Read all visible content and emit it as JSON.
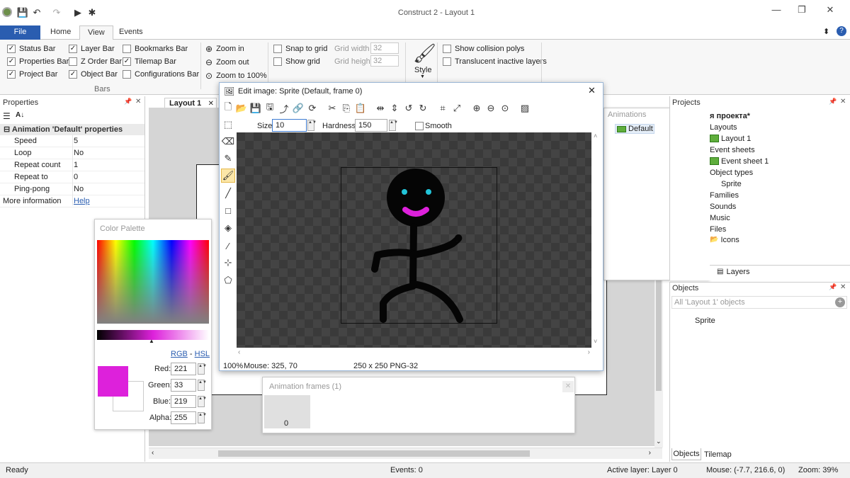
{
  "window": {
    "title": "Construct 2 - Layout 1",
    "min": "—",
    "restore": "❐",
    "close": "✕"
  },
  "ribbon_tabs": [
    "File",
    "Home",
    "View",
    "Events"
  ],
  "bars": {
    "col1": [
      {
        "label": "Status Bar",
        "checked": true
      },
      {
        "label": "Properties Bar",
        "checked": true
      },
      {
        "label": "Project Bar",
        "checked": true
      }
    ],
    "col2": [
      {
        "label": "Layer Bar",
        "checked": true
      },
      {
        "label": "Z Order Bar",
        "checked": false
      },
      {
        "label": "Object Bar",
        "checked": true
      }
    ],
    "col3": [
      {
        "label": "Bookmarks Bar",
        "checked": false
      },
      {
        "label": "Tilemap Bar",
        "checked": true
      },
      {
        "label": "Configurations Bar",
        "checked": false
      }
    ],
    "group_label": "Bars"
  },
  "zoom": {
    "in": "Zoom in",
    "out": "Zoom out",
    "reset": "Zoom to 100%"
  },
  "grid": {
    "snap": "Snap to grid",
    "show": "Show grid",
    "width_label": "Grid width",
    "width": "32",
    "height_label": "Grid height",
    "height": "32"
  },
  "style_label": "Style",
  "display": {
    "collision": "Show collision polys",
    "translucent": "Translucent inactive layers"
  },
  "properties": {
    "title": "Properties",
    "section": "Animation 'Default' properties",
    "rows": [
      {
        "key": "Speed",
        "value": "5"
      },
      {
        "key": "Loop",
        "value": "No"
      },
      {
        "key": "Repeat count",
        "value": "1"
      },
      {
        "key": "Repeat to",
        "value": "0"
      },
      {
        "key": "Ping-pong",
        "value": "No"
      }
    ],
    "more_label": "More information",
    "more_link": "Help"
  },
  "layout_tab": "Layout 1",
  "editor": {
    "title": "Edit image: Sprite (Default, frame 0)",
    "size_label": "Size",
    "size": "10",
    "hardness_label": "Hardness",
    "hardness": "150",
    "smooth": "Smooth",
    "status_zoom": "100%",
    "status_mouse": "Mouse: 325, 70",
    "status_dims": "250 x 250  PNG-32"
  },
  "palette": {
    "title": "Color Palette",
    "rgb": "RGB",
    "sep": " - ",
    "hsl": "HSL",
    "red_label": "Red:",
    "red": "221",
    "green_label": "Green:",
    "green": "33",
    "blue_label": "Blue:",
    "blue": "219",
    "alpha_label": "Alpha:",
    "alpha": "255",
    "primary_color": "#dd21db"
  },
  "animations": {
    "title": "Animations",
    "item": "Default"
  },
  "frames": {
    "title": "Animation frames (1)",
    "frame": "0"
  },
  "projects": {
    "title": "Projects",
    "items": [
      "я проекта*",
      "Layouts",
      "Layout 1",
      "Event sheets",
      "Event sheet 1",
      "Object types",
      "Sprite",
      "Families",
      "Sounds",
      "Music",
      "Files",
      "Icons"
    ],
    "layers_tab": "Layers"
  },
  "objects": {
    "title": "Objects",
    "filter": "All 'Layout 1' objects",
    "item": "Sprite",
    "tab1": "Objects",
    "tab2": "Tilemap"
  },
  "statusbar": {
    "ready": "Ready",
    "events": "Events: 0",
    "layer": "Active layer: Layer 0",
    "mouse": "Mouse: (-7.7, 216.6, 0)",
    "zoom": "Zoom: 39%"
  },
  "colors": {
    "accent": "#2a5db0",
    "figure_eyes": "#22c4d8",
    "figure_mouth": "#dd21db"
  }
}
